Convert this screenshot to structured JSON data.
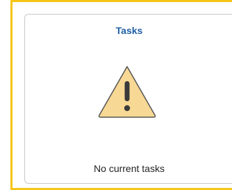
{
  "tile": {
    "title": "Tasks",
    "message": "No current tasks",
    "icon": "warning-triangle-icon"
  },
  "colors": {
    "highlight_border": "#f5c518",
    "title": "#1f5fa6",
    "warning_fill": "#f7d894",
    "warning_stroke": "#555555"
  }
}
